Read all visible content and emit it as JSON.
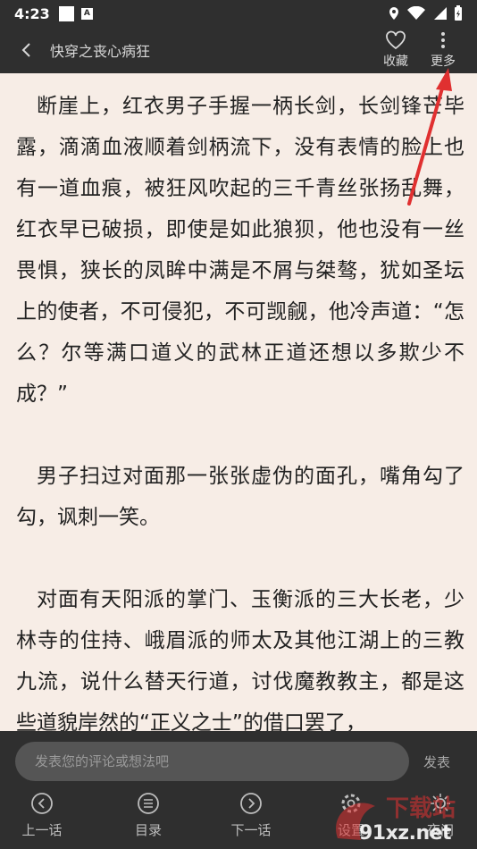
{
  "status": {
    "time": "4:23",
    "badge": "A"
  },
  "header": {
    "title": "快穿之丧心病狂",
    "favorite_label": "收藏",
    "more_label": "更多"
  },
  "content": {
    "paragraphs": [
      "断崖上，红衣男子手握一柄长剑，长剑锋芒毕露，滴滴血液顺着剑柄流下，没有表情的脸上也有一道血痕，被狂风吹起的三千青丝张扬乱舞，红衣早已破损，即使是如此狼狈，他也没有一丝畏惧，狭长的凤眸中满是不屑与桀骜，犹如圣坛上的使者，不可侵犯，不可觊觎，他冷声道：“怎么？尔等满口道义的武林正道还想以多欺少不成？”",
      "男子扫过对面那一张张虚伪的面孔，嘴角勾了勾，讽刺一笑。",
      "对面有天阳派的掌门、玉衡派的三大长老，少林寺的住持、峨眉派的师太及其他江湖上的三教九流，说什么替天行道，讨伐魔教教主，都是这些道貌岸然的“正义之士”的借口罢了，"
    ]
  },
  "comment": {
    "placeholder": "发表您的评论或想法吧",
    "publish_label": "发表"
  },
  "bottom_nav": {
    "prev": "上一话",
    "catalog": "目录",
    "next": "下一话",
    "settings": "设置",
    "brightness": "夜间"
  },
  "watermark": {
    "site": "91xz.net",
    "label": "下载站"
  },
  "colors": {
    "bar": "#2f2f2f",
    "page": "#f7ede6",
    "annotation": "#e03030"
  }
}
